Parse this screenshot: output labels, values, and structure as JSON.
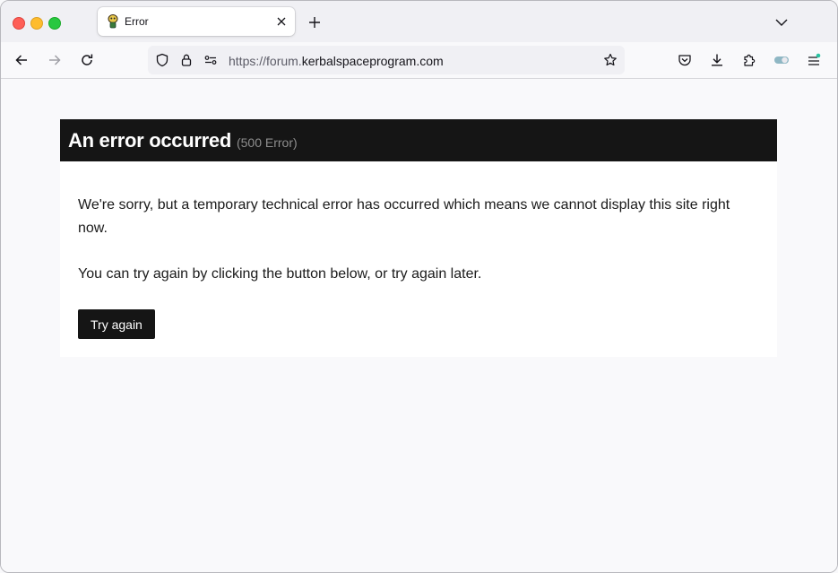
{
  "browser": {
    "tab": {
      "title": "Error"
    },
    "url": {
      "prefix": "https://forum.",
      "domain": "kerbalspaceprogram.com"
    }
  },
  "page": {
    "heading": "An error occurred",
    "code": "(500 Error)",
    "message1": "We're sorry, but a temporary technical error has occurred which means we cannot display this site right now.",
    "message2": "You can try again by clicking the button below, or try again later.",
    "button": "Try again"
  },
  "icons": {
    "back": "arrow-left-icon",
    "forward": "arrow-right-icon",
    "reload": "reload-icon",
    "tracking": "shield-icon",
    "lock": "lock-icon",
    "permissions": "permissions-icon",
    "bookmark": "star-icon",
    "pocket": "pocket-icon",
    "downloads": "download-icon",
    "extensions": "puzzle-icon",
    "toggle": "toggle-icon",
    "menu": "hamburger-menu-icon"
  },
  "colors": {
    "header_bg": "#151515",
    "button_bg": "#151515",
    "page_bg": "#f9f9fb"
  }
}
